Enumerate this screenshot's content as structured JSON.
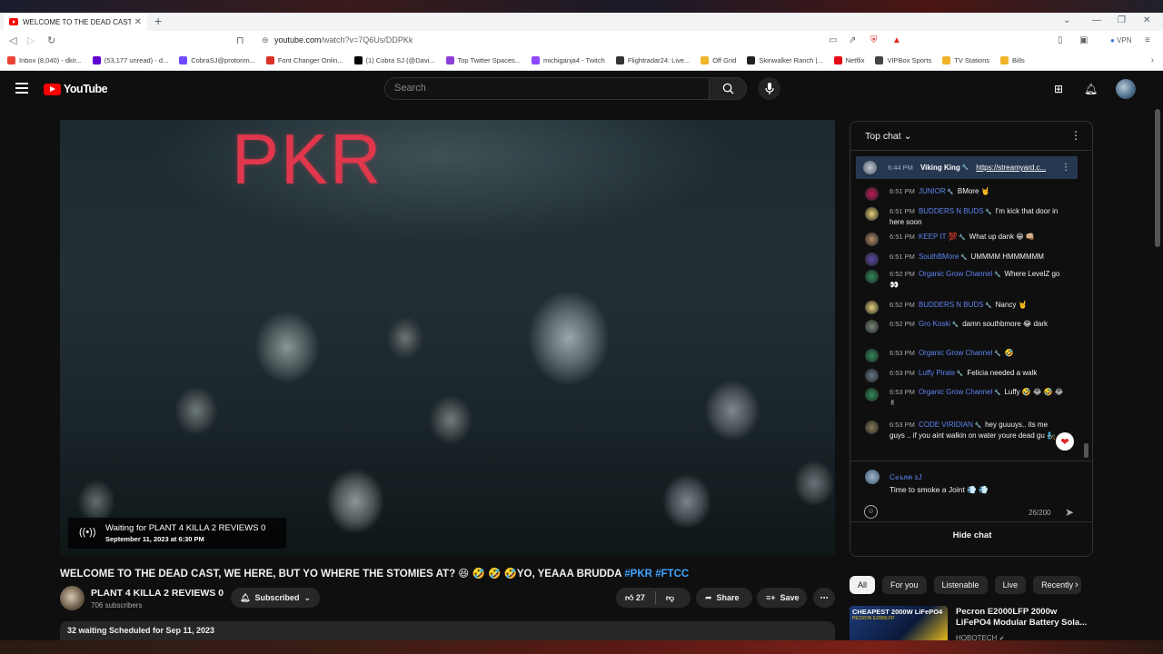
{
  "browser": {
    "tab_title": "WELCOME TO THE DEAD CAST, W",
    "url_prefix": "youtube.com",
    "url_path": "/watch?v=7Q6Us/DDPKk",
    "vpn": "VPN",
    "bookmarks": [
      {
        "label": "Inbox (8,040) - dkir...",
        "color": "#ea4335"
      },
      {
        "label": "(53,177 unread) - d...",
        "color": "#6001d2"
      },
      {
        "label": "CobraSJ@protonm...",
        "color": "#6d4aff"
      },
      {
        "label": "Font Changer Onlin...",
        "color": "#d93025"
      },
      {
        "label": "(1) Cobra SJ (@Davi...",
        "color": "#000000"
      },
      {
        "label": "Top Twitter Spaces...",
        "color": "#8f3fd9"
      },
      {
        "label": "michiganja4 - Twitch",
        "color": "#9146ff"
      },
      {
        "label": "Flightradar24: Live...",
        "color": "#333333"
      },
      {
        "label": "Off Grid",
        "color": "#f0b429"
      },
      {
        "label": "Skinwalker Ranch |...",
        "color": "#222222"
      },
      {
        "label": "Netflix",
        "color": "#e50914"
      },
      {
        "label": "VIPBox Sports",
        "color": "#444444"
      },
      {
        "label": "TV Stations",
        "color": "#f0b429"
      },
      {
        "label": "Bills",
        "color": "#f0b429"
      }
    ]
  },
  "youtube": {
    "logo_text": "YouTube",
    "search_placeholder": "Search"
  },
  "video": {
    "overlay_text": "PKR",
    "waiting_line1": "Waiting for PLANT 4 KILLA 2 REVIEWS 0",
    "waiting_line2": "September 11, 2023 at 6:30 PM",
    "title": "WELCOME TO THE DEAD CAST, WE HERE, BUT YO WHERE THE STOMIES AT? 😆 🤣 🤣 🤣YO, YEAAA BRUDDA ",
    "tags": "#PKR #FTCC",
    "channel_name": "PLANT 4 KILLA 2 REVIEWS 0",
    "subscribers": "706 subscribers",
    "subscribed_label": "Subscribed",
    "likes": "27",
    "share_label": "Share",
    "save_label": "Save",
    "description_summary": "32 waiting  Scheduled for Sep 11, 2023"
  },
  "chat": {
    "header": "Top chat",
    "pinned": {
      "time": "6:44 PM",
      "author": "Viking King",
      "text": "https://streamyard.c..."
    },
    "messages": [
      {
        "time": "6:51 PM",
        "author": "JUNIOR",
        "text": "BMore 🤘",
        "color": "#c2185b"
      },
      {
        "time": "6:51 PM",
        "author": "BUDDERS N BUDS",
        "text": "I'm kick that door in here soon",
        "color": "#e8d37a"
      },
      {
        "time": "6:51 PM",
        "author": "KEEP IT 💯",
        "text": "What up dank 😁 👊🏼",
        "color": "#b08a6a"
      },
      {
        "time": "6:51 PM",
        "author": "SouthBMore",
        "text": "UMMMM HMMMMMM",
        "color": "#5e4aa8"
      },
      {
        "time": "6:52 PM",
        "author": "Organic Grow Channel",
        "text": "Where LevelZ go 👀",
        "color": "#2e8b57"
      },
      {
        "time": "6:52 PM",
        "author": "BUDDERS N BUDS",
        "text": "Nancy 🤘",
        "color": "#e8d37a"
      },
      {
        "time": "6:52 PM",
        "author": "Gro Koski",
        "text": "damn southbmore 😂 dark",
        "color": "#7a8a7a"
      },
      {
        "time": "6:53 PM",
        "author": "Organic Grow Channel",
        "text": "🤣",
        "color": "#2e8b57"
      },
      {
        "time": "6:53 PM",
        "author": "Luffy Pirate",
        "text": "Felicia needed a walk",
        "color": "#667788"
      },
      {
        "time": "6:53 PM",
        "author": "Organic Grow Channel",
        "text": "Luffy 🤣 😂 🤣 😂 ✌",
        "color": "#2e8b57"
      },
      {
        "time": "6:53 PM",
        "author": "CODE VIRIDIAN",
        "text": "hey guuuys.. its me guys .. if you aint walkin on water youre dead gu 🧞",
        "color": "#8a7a5a"
      }
    ],
    "compose_name": "C๏ъяค sJ",
    "compose_text": "Time to smoke a Joint 💨 💨",
    "counter": "26/200",
    "hide_chat": "Hide chat"
  },
  "recommendations": {
    "chips": [
      "All",
      "For you",
      "Listenable",
      "Live",
      "Recently"
    ],
    "items": [
      {
        "thumb_text": "CHEAPEST 2000W LiFePO4",
        "thumb_sub": "PECRON E2000LFP",
        "title": "Pecron E2000LFP 2000w LiFePO4 Modular Battery Sola...",
        "channel": "HOBOTECH"
      }
    ]
  }
}
